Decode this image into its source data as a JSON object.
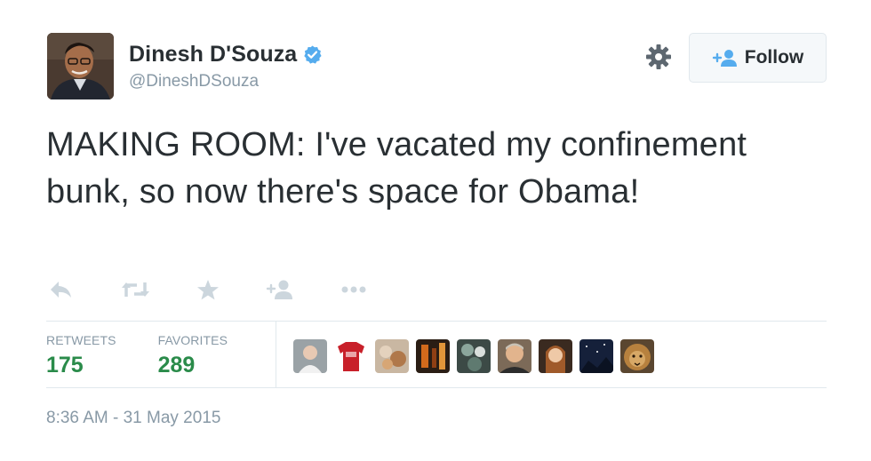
{
  "author": {
    "name": "Dinesh D'Souza",
    "handle": "@DineshDSouza",
    "verified": true,
    "avatar_icon": "profile-photo"
  },
  "header": {
    "gear_icon": "gear-icon",
    "follow_label": "Follow"
  },
  "tweet": {
    "text": "MAKING ROOM: I've vacated my confinement bunk, so now there's space for Obama!"
  },
  "actions": [
    {
      "name": "reply",
      "icon": "reply-icon"
    },
    {
      "name": "retweet",
      "icon": "retweet-icon"
    },
    {
      "name": "favorite",
      "icon": "star-icon"
    },
    {
      "name": "follow",
      "icon": "add-user-icon"
    },
    {
      "name": "more",
      "icon": "more-icon"
    }
  ],
  "stats": {
    "retweets_label": "RETWEETS",
    "retweets_value": "175",
    "favorites_label": "FAVORITES",
    "favorites_value": "289"
  },
  "favoriters_count_shown": 9,
  "timestamp": "8:36 AM - 31 May 2015",
  "colors": {
    "text": "#292f33",
    "muted": "#8899a6",
    "stat_green": "#2a8b4a",
    "verified_blue": "#55acee",
    "icon_gray": "#ccd6dd",
    "divider": "#e1e8ed",
    "follow_bg": "#f5f8fa",
    "follow_icon_blue": "#55acee"
  }
}
